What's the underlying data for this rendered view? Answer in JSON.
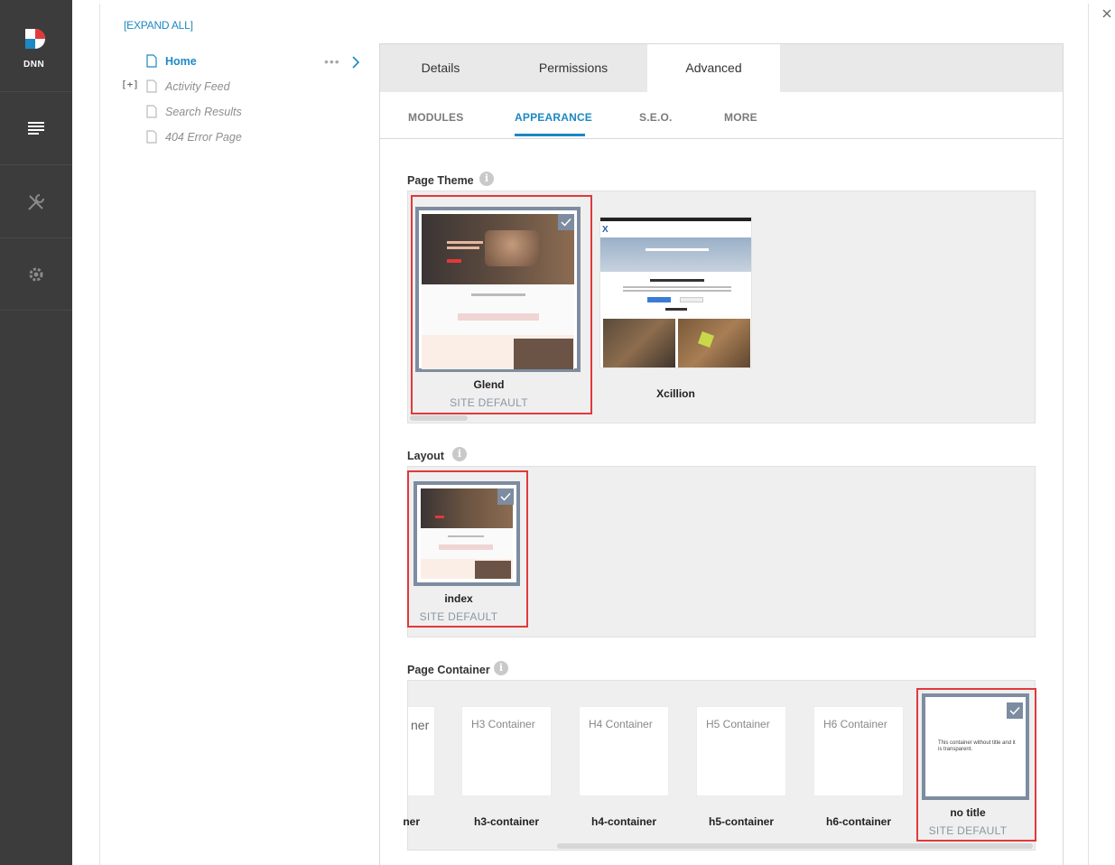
{
  "sidebar": {
    "logo_text": "DNN",
    "items": [
      {
        "icon": "content-icon",
        "active": true
      },
      {
        "icon": "wrench-icon",
        "active": false
      },
      {
        "icon": "gear-icon",
        "active": false
      }
    ]
  },
  "tree": {
    "expand_all": "[EXPAND ALL]",
    "expand_toggle": "[+]",
    "pages": [
      "Home",
      "Activity Feed",
      "Search Results",
      "404 Error Page"
    ]
  },
  "tabs": [
    "Details",
    "Permissions",
    "Advanced"
  ],
  "active_tab": "Advanced",
  "subtabs": [
    "MODULES",
    "APPEARANCE",
    "S.E.O.",
    "MORE"
  ],
  "active_subtab": "APPEARANCE",
  "page_theme": {
    "label": "Page Theme",
    "items": [
      {
        "name": "Glend",
        "badge": "SITE DEFAULT",
        "selected": true
      },
      {
        "name": "Xcillion",
        "badge": "",
        "selected": false
      }
    ]
  },
  "layout": {
    "label": "Layout",
    "items": [
      {
        "name": "index",
        "badge": "SITE DEFAULT",
        "selected": true
      }
    ]
  },
  "page_container": {
    "label": "Page Container",
    "items": [
      {
        "name": "ner",
        "thumb": "ner"
      },
      {
        "name": "h3-container",
        "thumb": "H3 Container"
      },
      {
        "name": "h4-container",
        "thumb": "H4 Container"
      },
      {
        "name": "h5-container",
        "thumb": "H5 Container"
      },
      {
        "name": "h6-container",
        "thumb": "H6 Container"
      },
      {
        "name": "no title",
        "badge": "SITE DEFAULT",
        "thumb": "This container without title and it is transparent.",
        "selected": true
      }
    ]
  },
  "colors": {
    "accent": "#1e88c3",
    "highlight": "#e2393b",
    "selected_frame": "#7d8ca0",
    "sidebar_bg": "#3d3c3c"
  }
}
